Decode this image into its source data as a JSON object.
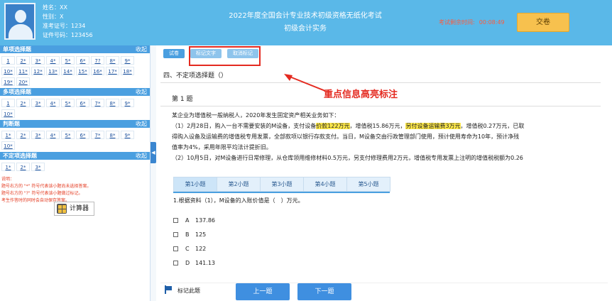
{
  "header": {
    "candidate": {
      "name_label": "姓名：",
      "name": "XX",
      "gender_label": "性别：",
      "gender": "X",
      "ticket_label": "准考证号：",
      "ticket": "1234",
      "id_label": "证件号码：",
      "id": "123456"
    },
    "title_line1": "2022年度全国会计专业技术初级资格无纸化考试",
    "title_line2": "初级会计实务",
    "timer_label": "考试剩余时间:",
    "timer_value": "00:08:49",
    "submit_label": "交卷"
  },
  "sidebar": {
    "sections": [
      {
        "title": "单项选择题",
        "collapse": "收起",
        "items": [
          "1",
          "2*",
          "3*",
          "4*",
          "5*",
          "6*",
          "7?",
          "8*",
          "9*",
          "10*",
          "11*",
          "12*",
          "13*",
          "14*",
          "15*",
          "16*",
          "17*",
          "18*",
          "19*",
          "20*"
        ]
      },
      {
        "title": "多项选择题",
        "collapse": "收起",
        "items": [
          "1",
          "2*",
          "3*",
          "4*",
          "5*",
          "6*",
          "7*",
          "8*",
          "9*",
          "10*"
        ]
      },
      {
        "title": "判断题",
        "collapse": "收起",
        "items": [
          "1*",
          "2*",
          "3*",
          "4*",
          "5*",
          "6*",
          "7*",
          "8*",
          "9*",
          "10*"
        ]
      },
      {
        "title": "不定项选择题",
        "collapse": "收起",
        "items": [
          "1*",
          "2*",
          "3*"
        ]
      }
    ],
    "notes": [
      "说明：",
      "题号右方的 \"*\" 符号代表该小题尚未选择答案。",
      "题号右方的 \"?\" 符号代表该小题做过标记。",
      "考生作答时的同时会自动保存答案。"
    ],
    "calculator_label": "计算器",
    "handle_glyph": "◀"
  },
  "main": {
    "top_tabs": [
      "试卷",
      "标记文字",
      "取消标记"
    ],
    "section_title": "四、不定项选择题（）",
    "question_number": "第 1 题",
    "stem_lines": [
      [
        "某企业为增值税一般纳税人，2020年发生固定资产相关业务如下："
      ],
      [
        "（1）2月28日，购入一台不需要安装的M设备，支付设备",
        "价款122万元",
        "，增值税15.86万元，",
        "另付设备运输费3万元",
        "，增值税0.27万元，已取"
      ],
      [
        "得购入设备及运输费的增值税专用发票，全部款项以银行存款支付。当日，M设备交由行政管理部门使用，预计使用寿命为10年，预计净残"
      ],
      [
        "值率为4%，采用年限平均法计提折旧。"
      ],
      [
        "（2）10月5日，对M设备进行日常修理，从仓库领用维修材料0.5万元，另支付修理费用2万元，增值税专用发票上注明的增值税税额为0.26"
      ]
    ],
    "annotation": "重点信息高亮标注",
    "sub_tabs": [
      "第1小题",
      "第2小题",
      "第3小题",
      "第4小题",
      "第5小题"
    ],
    "question_text": "1.根据资料（1），M设备的入账价值是（　）万元。",
    "options": [
      {
        "letter": "A",
        "text": "137.86"
      },
      {
        "letter": "B",
        "text": "125"
      },
      {
        "letter": "C",
        "text": "122"
      },
      {
        "letter": "D",
        "text": "141.13"
      }
    ],
    "mark_label": "标记此题",
    "prev_label": "上一题",
    "next_label": "下一题"
  },
  "colors": {
    "header": "#5ab8e8",
    "section_header": "#4a9fe0",
    "highlight": "#ffe94a",
    "annotation": "#e42a20",
    "submit": "#f7c14e"
  }
}
